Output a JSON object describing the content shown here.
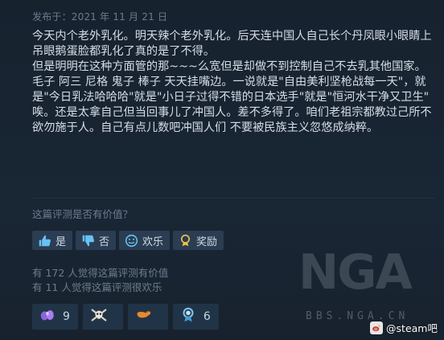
{
  "review": {
    "posted": "发布于：2021 年 11 月 21 日",
    "paragraphs": [
      "今天内个老外乳化。明天辣个老外乳化。后天连中国人自己长个丹凤眼小眼睛上吊眼鹅蛋脸都乳化了真的是了不得。",
      "但是明明在这种方面管的那~~~么宽但是却做不到控制自己不去乳其他国家。毛子 阿三 尼格 鬼子 棒子 天天挂嘴边。一说就是\"自由美利坚枪战每一天\"，就是\"今日乳法哈哈哈\"就是\"小日子过得不错的日本选手\"就是\"恒河水干净又卫生\"",
      "唉。还是太拿自己但当回事儿了冲国人。差不多得了。咱们老祖宗都教过己所不欲勿施于人。自己有点儿数吧冲国人们 不要被民族主义忽悠成纳粹。"
    ]
  },
  "feedback": {
    "question": "这篇评测是否有价值？",
    "yes_label": "是",
    "no_label": "否",
    "funny_label": "欢乐",
    "award_label": "奖励"
  },
  "stats": {
    "helpful": "有 172 人觉得这篇评测有价值",
    "funny": "有 11 人觉得这篇评测很欢乐"
  },
  "awards": [
    {
      "icon": "purple-hands-award-icon",
      "count": "9"
    },
    {
      "icon": "bone-skull-award-icon",
      "count": ""
    },
    {
      "icon": "orange-arm-award-icon",
      "count": ""
    },
    {
      "icon": "blue-medal-award-icon",
      "count": "6"
    }
  ],
  "watermark": {
    "logo": "NGA",
    "site": "BBS.NGA.CN",
    "weibo": "@steam吧"
  },
  "colors": {
    "background": "#1b2838",
    "button": "#2a3d52",
    "muted_text": "#6b7c8e",
    "body_text": "#d5dde5"
  }
}
